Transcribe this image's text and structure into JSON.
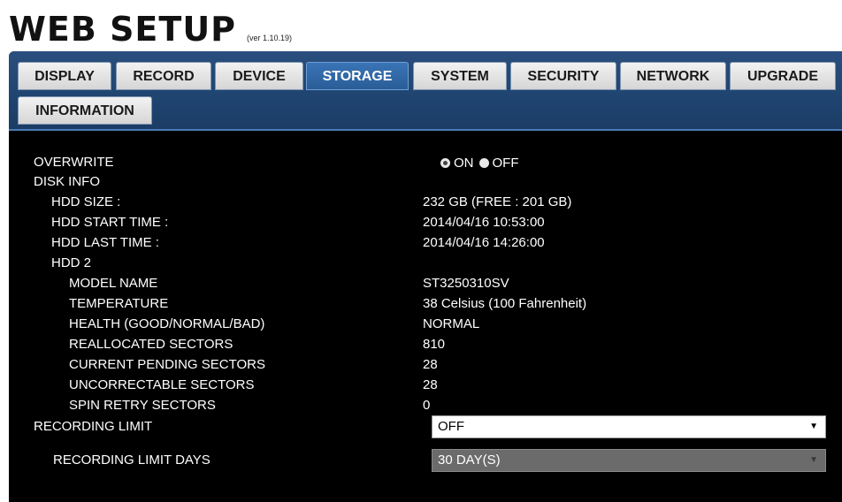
{
  "app": {
    "title": "WEB SETUP",
    "version": "(ver 1.10.19)"
  },
  "tabs": [
    {
      "label": "DISPLAY"
    },
    {
      "label": "RECORD"
    },
    {
      "label": "DEVICE"
    },
    {
      "label": "STORAGE",
      "active": true
    },
    {
      "label": "SYSTEM"
    },
    {
      "label": "SECURITY"
    },
    {
      "label": "NETWORK"
    },
    {
      "label": "UPGRADE"
    },
    {
      "label": "INFORMATION"
    }
  ],
  "storage": {
    "overwrite": {
      "label": "OVERWRITE",
      "options": [
        "ON",
        "OFF"
      ],
      "selected": "ON"
    },
    "disk_info_label": "DISK INFO",
    "hdd_size": {
      "label": "HDD SIZE :",
      "value": "232 GB (FREE : 201 GB)"
    },
    "hdd_start_time": {
      "label": "HDD START TIME :",
      "value": "2014/04/16 10:53:00"
    },
    "hdd_last_time": {
      "label": "HDD LAST TIME :",
      "value": "2014/04/16 14:26:00"
    },
    "hdd2": {
      "label": "HDD 2",
      "model_name": {
        "label": "MODEL NAME",
        "value": "ST3250310SV"
      },
      "temperature": {
        "label": "TEMPERATURE",
        "value": "38 Celsius (100 Fahrenheit)"
      },
      "health": {
        "label": "HEALTH (GOOD/NORMAL/BAD)",
        "value": "NORMAL"
      },
      "reallocated": {
        "label": "REALLOCATED SECTORS",
        "value": "810"
      },
      "current_pending": {
        "label": "CURRENT PENDING SECTORS",
        "value": "28"
      },
      "uncorrectable": {
        "label": "UNCORRECTABLE SECTORS",
        "value": "28"
      },
      "spin_retry": {
        "label": "SPIN RETRY SECTORS",
        "value": "0"
      }
    },
    "recording_limit": {
      "label": "RECORDING LIMIT",
      "value": "OFF"
    },
    "recording_limit_days": {
      "label": "RECORDING LIMIT DAYS",
      "value": "30 DAY(S)"
    }
  },
  "colors": {
    "tabbar": "#1f4470",
    "active_tab": "#2a5d97",
    "panel_bg": "#000000",
    "text": "#ffffff"
  }
}
